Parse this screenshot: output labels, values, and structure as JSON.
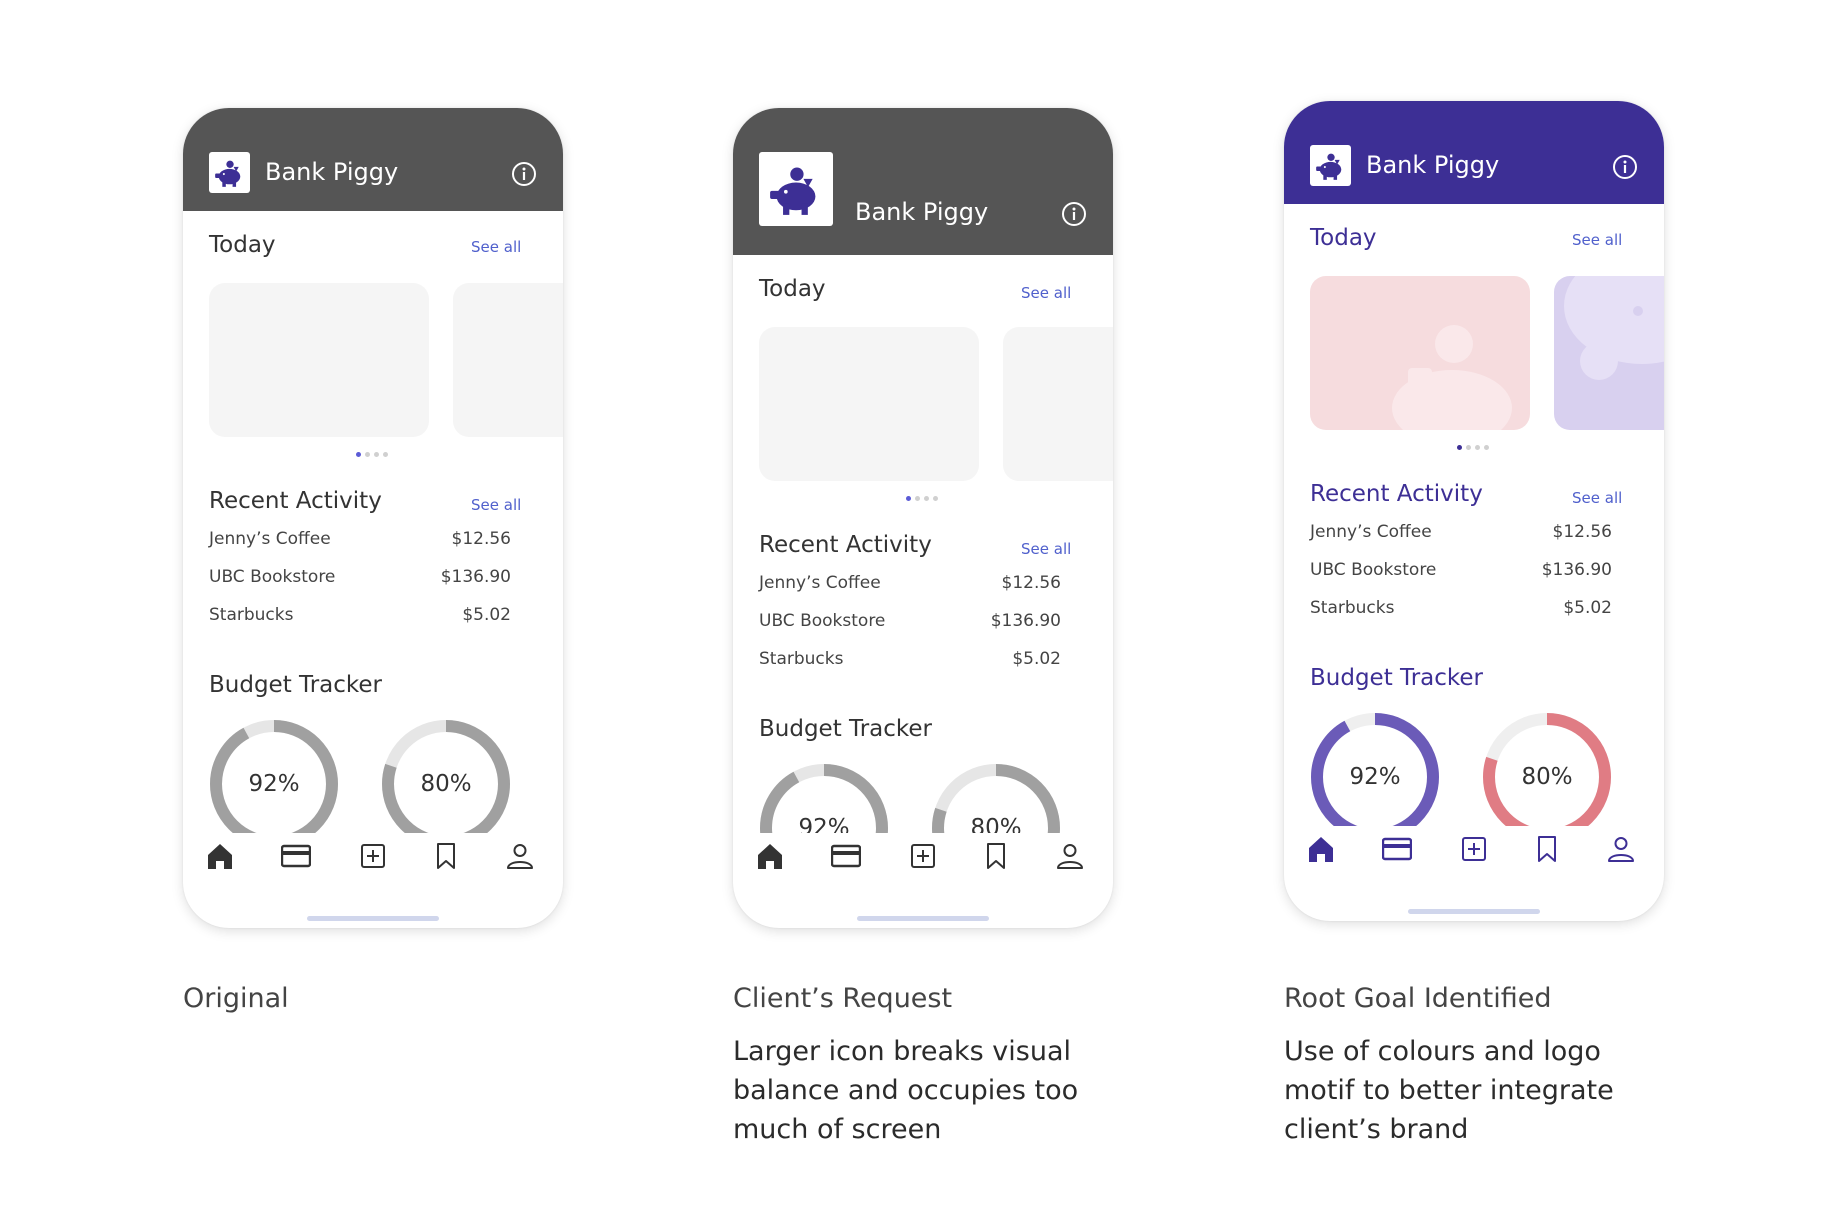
{
  "columns": [
    {
      "app_title": "Bank Piggy",
      "today": "Today",
      "see_all": "See all",
      "recent": "Recent Activity",
      "transactions": [
        {
          "name": "Jenny’s Coffee",
          "amount": "$12.56"
        },
        {
          "name": "UBC Bookstore",
          "amount": "$136.90"
        },
        {
          "name": "Starbucks",
          "amount": "$5.02"
        }
      ],
      "budget": "Budget Tracker",
      "donuts": [
        {
          "label": "92%",
          "value": 0.92
        },
        {
          "label": "80%",
          "value": 0.8
        }
      ],
      "caption_title": "Original",
      "caption_desc": ""
    },
    {
      "app_title": "Bank Piggy",
      "today": "Today",
      "see_all": "See all",
      "recent": "Recent Activity",
      "transactions": [
        {
          "name": "Jenny’s Coffee",
          "amount": "$12.56"
        },
        {
          "name": "UBC Bookstore",
          "amount": "$136.90"
        },
        {
          "name": "Starbucks",
          "amount": "$5.02"
        }
      ],
      "budget": "Budget Tracker",
      "donuts": [
        {
          "label": "92%",
          "value": 0.92
        },
        {
          "label": "80%",
          "value": 0.8
        }
      ],
      "caption_title": "Client’s Request",
      "caption_desc": "Larger icon breaks visual balance and occupies too much of screen"
    },
    {
      "app_title": "Bank Piggy",
      "today": "Today",
      "see_all": "See all",
      "recent": "Recent Activity",
      "transactions": [
        {
          "name": "Jenny’s Coffee",
          "amount": "$12.56"
        },
        {
          "name": "UBC Bookstore",
          "amount": "$136.90"
        },
        {
          "name": "Starbucks",
          "amount": "$5.02"
        }
      ],
      "budget": "Budget Tracker",
      "donuts": [
        {
          "label": "92%",
          "value": 0.92
        },
        {
          "label": "80%",
          "value": 0.8
        }
      ],
      "caption_title": "Root Goal Identified",
      "caption_desc": "Use of colours and logo motif to better integrate client’s brand"
    }
  ],
  "carousel": {
    "active_index": 0,
    "count": 4
  },
  "icons": [
    "piggy-bank-logo-icon",
    "info-icon",
    "home-icon",
    "card-icon",
    "add-icon",
    "bookmark-icon",
    "profile-icon"
  ],
  "colors": {
    "header_gray": "#555555",
    "brand_purple": "#3d2f95",
    "link_blue": "#5060cc",
    "donut_gray": "#a0a0a0",
    "donut_track": "#e6e6e6",
    "donut_purple": "#6b5bb8",
    "donut_pink": "#e07c84",
    "card_pink": "#f6dcde",
    "card_lavender": "#d8d0ef"
  }
}
